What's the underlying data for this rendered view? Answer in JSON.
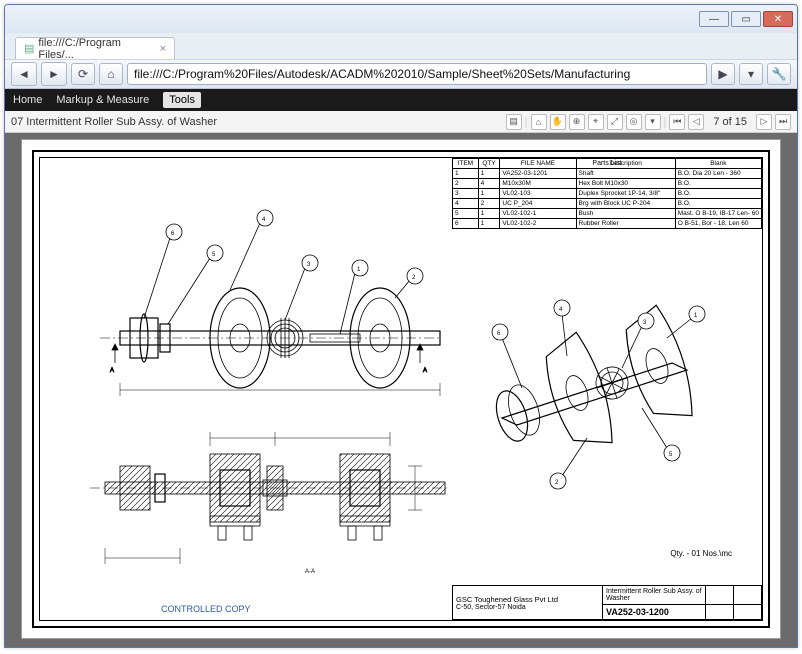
{
  "window": {
    "tab_title": "file:///C:/Program Files/...",
    "url": "file:///C:/Program%20Files/Autodesk/ACADM%202010/Sample/Sheet%20Sets/Manufacturing"
  },
  "menubar": {
    "home": "Home",
    "markup": "Markup & Measure",
    "tools": "Tools"
  },
  "docbar": {
    "title": "07 Intermittent Roller Sub Assy. of Washer",
    "page": "7 of 15"
  },
  "parts_list": {
    "title": "Parts List",
    "headers": [
      "ITEM",
      "QTY",
      "FILE NAME",
      "Description",
      "Blank"
    ],
    "rows": [
      [
        "1",
        "1",
        "VA252-03-1201",
        "Shaft",
        "B.O. Dia 20 Len - 360"
      ],
      [
        "2",
        "4",
        "M10x30M",
        "Hex Bolt M10x30",
        "B.O."
      ],
      [
        "3",
        "1",
        "VL02-103",
        "Duplex Sprocket 1P-14, 3/8\"",
        "B.O."
      ],
      [
        "4",
        "2",
        "UC P_204",
        "Brg with Block UC P-204",
        "B.O."
      ],
      [
        "5",
        "1",
        "VL02-102-1",
        "Bush",
        "Mast. O B-19, IB-17 Len- 60"
      ],
      [
        "6",
        "1",
        "VL02-102-2",
        "Rubber Roller",
        "O B-51, Bor - 18, Len 60"
      ]
    ]
  },
  "qty_note": "Qty. - 01 Nos.\\mc",
  "controlled": "CONTROLLED COPY",
  "title_block": {
    "company": "GSC Toughened Glass Pvt Ltd",
    "address": "C-50, Sector-57 Noida",
    "drawing_title": "Intermittent Roller Sub Assy. of Washer",
    "drawing_no": "VA252-03-1200"
  },
  "labels": {
    "section_a1": "A",
    "section_a2": "A",
    "section_name": "A-A",
    "balloons": [
      "1",
      "2",
      "3",
      "4",
      "5",
      "6"
    ]
  }
}
